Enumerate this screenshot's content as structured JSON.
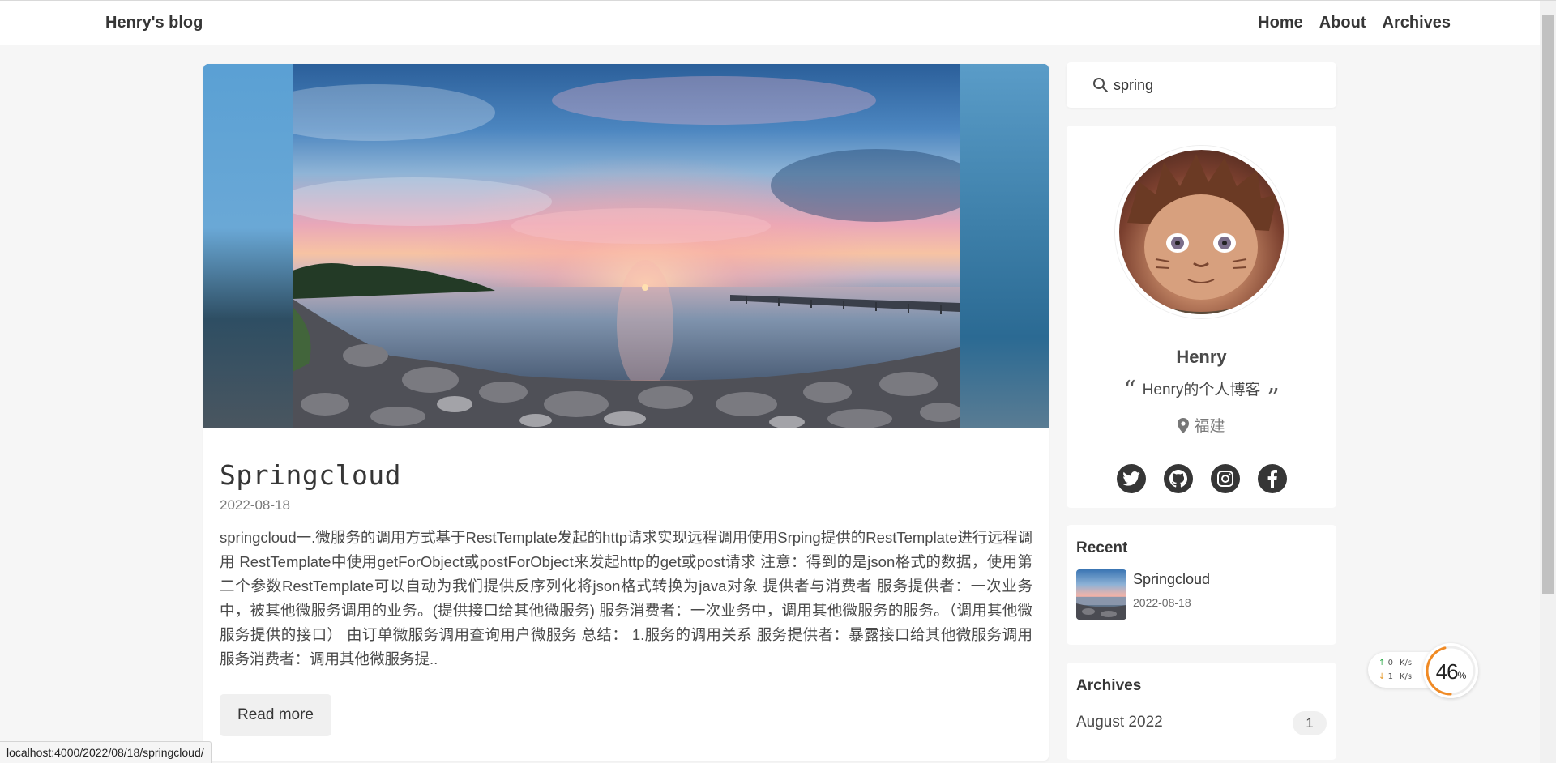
{
  "nav": {
    "brand": "Henry's blog",
    "links": [
      "Home",
      "About",
      "Archives"
    ]
  },
  "post": {
    "title": "Springcloud",
    "date": "2022-08-18",
    "excerpt": "springcloud一.微服务的调用方式基于RestTemplate发起的http请求实现远程调用使用Srping提供的RestTemplate进行远程调用 RestTemplate中使用getForObject或postForObject来发起http的get或post请求 注意：得到的是json格式的数据，使用第二个参数RestTemplate可以自动为我们提供反序列化将json格式转换为java对象 提供者与消费者 服务提供者：一次业务中，被其他微服务调用的业务。(提供接口给其他微服务) 服务消费者：一次业务中，调用其他微服务的服务。（调用其他微服务提供的接口） 由订单微服务调用查询用户微服务 总结： 1.服务的调用关系 服务提供者：暴露接口给其他微服务调用 服务消费者：调用其他微服务提..",
    "read_more": "Read more"
  },
  "search": {
    "value": "spring"
  },
  "profile": {
    "name": "Henry",
    "tagline": "Henry的个人博客",
    "quote_open": "“",
    "quote_close": "”",
    "location": "福建",
    "social": [
      "twitter-icon",
      "github-icon",
      "instagram-icon",
      "facebook-icon"
    ]
  },
  "recent": {
    "title": "Recent",
    "items": [
      {
        "title": "Springcloud",
        "date": "2022-08-18"
      }
    ]
  },
  "archives": {
    "title": "Archives",
    "items": [
      {
        "label": "August 2022",
        "count": "1"
      }
    ]
  },
  "network": {
    "upload": "0",
    "download": "1",
    "unit": "K/s",
    "usage": "46",
    "usage_suffix": "%",
    "usage_fraction": 0.46
  },
  "status_bar": {
    "url": "localhost:4000/2022/08/18/springcloud/"
  },
  "colors": {
    "accent_orange": "#f08a24",
    "upload_green": "#2eaa4a",
    "download_orange": "#e69a2a"
  }
}
